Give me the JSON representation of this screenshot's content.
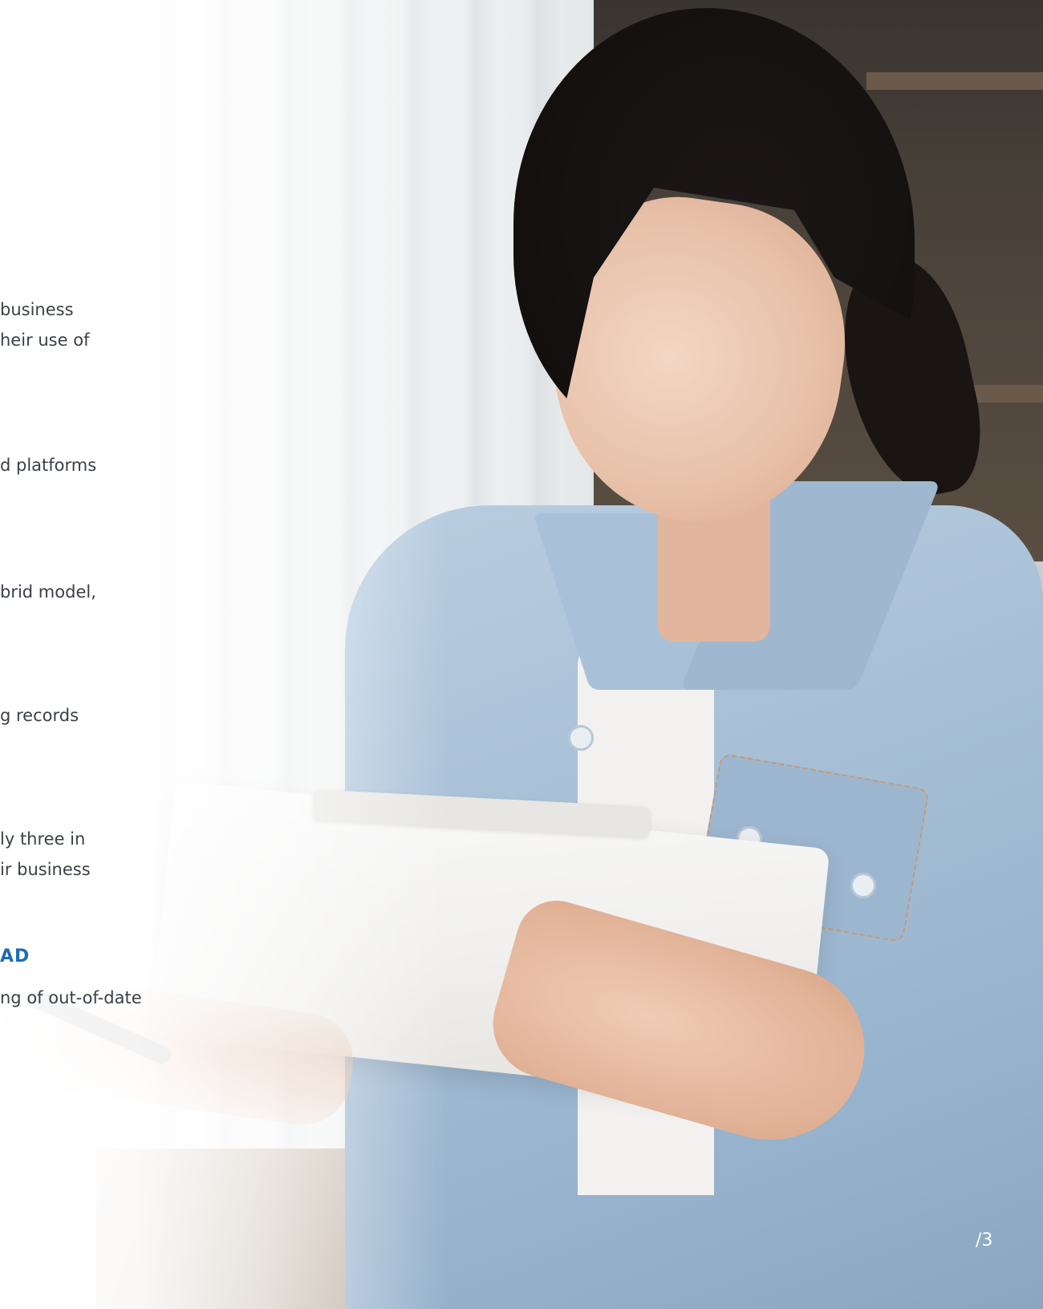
{
  "text_fragments": {
    "line1": "business",
    "line2": "heir use of",
    "line3": "d platforms",
    "line4": "brid model,",
    "line5": "g records",
    "line6": "ly three in",
    "line7": "ir business",
    "heading": "AD",
    "line8": "ng of out-of-date"
  },
  "page_number": "/3"
}
